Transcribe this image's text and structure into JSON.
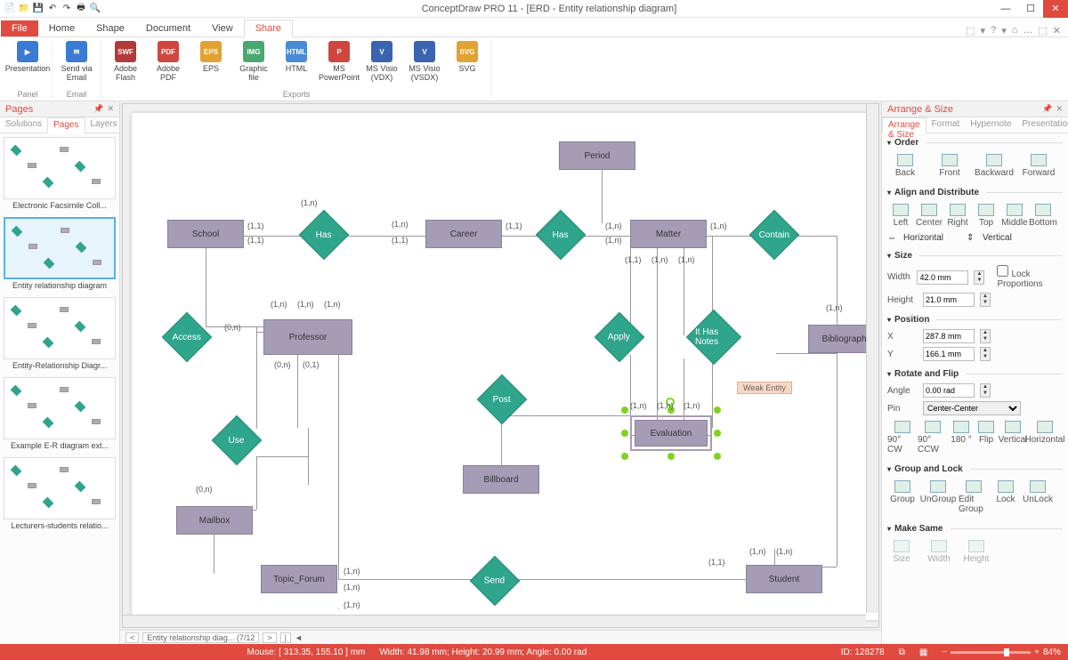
{
  "app": {
    "title": "ConceptDraw PRO 11 - [ERD - Entity relationship diagram]"
  },
  "window_buttons": {
    "min": "—",
    "max": "☐",
    "close": "✕"
  },
  "qat": [
    "📄",
    "📁",
    "💾",
    "↶",
    "↷",
    "🖶",
    "🔍"
  ],
  "ribbon_tabs": {
    "file": "File",
    "home": "Home",
    "shape": "Shape",
    "document": "Document",
    "view": "View",
    "share": "Share"
  },
  "right_icons": [
    "⬚",
    "▾",
    "?",
    "▾",
    "⌂",
    "…",
    "⬚",
    "✕"
  ],
  "ribbon": {
    "groups": [
      {
        "label": "Panel",
        "items": [
          {
            "name": "presentation-btn",
            "label": "Presentation",
            "color": "#3a7bd5",
            "icon": "▶"
          }
        ]
      },
      {
        "label": "Email",
        "items": [
          {
            "name": "send-email-btn",
            "label": "Send via Email",
            "color": "#3a7bd5",
            "icon": "✉"
          }
        ]
      },
      {
        "label": "Exports",
        "items": [
          {
            "name": "export-flash",
            "label": "Adobe Flash",
            "color": "#b23a3a",
            "icon": "SWF"
          },
          {
            "name": "export-pdf",
            "label": "Adobe PDF",
            "color": "#d0473f",
            "icon": "PDF"
          },
          {
            "name": "export-eps",
            "label": "EPS",
            "color": "#e2a233",
            "icon": "EPS"
          },
          {
            "name": "export-graphic",
            "label": "Graphic file",
            "color": "#4aa76f",
            "icon": "IMG"
          },
          {
            "name": "export-html",
            "label": "HTML",
            "color": "#4a8bd6",
            "icon": "HTML"
          },
          {
            "name": "export-ppt",
            "label": "MS PowerPoint",
            "color": "#d0473f",
            "icon": "P"
          },
          {
            "name": "export-vdx",
            "label": "MS Visio (VDX)",
            "color": "#3a63b0",
            "icon": "V"
          },
          {
            "name": "export-vsdx",
            "label": "MS Visio (VSDX)",
            "color": "#3a63b0",
            "icon": "V"
          },
          {
            "name": "export-svg",
            "label": "SVG",
            "color": "#e2a233",
            "icon": "SVG"
          }
        ]
      }
    ]
  },
  "pages_panel": {
    "title": "Pages",
    "tabs": {
      "solutions": "Solutions",
      "pages": "Pages",
      "layers": "Layers"
    },
    "thumbs": [
      {
        "label": "Electronic Facsimile Coll...",
        "selected": false
      },
      {
        "label": "Entity relationship diagram",
        "selected": true
      },
      {
        "label": "Entity-Relationship Diagr...",
        "selected": false
      },
      {
        "label": "Example E-R diagram ext...",
        "selected": false
      },
      {
        "label": "Lecturers-students relatio...",
        "selected": false
      }
    ]
  },
  "diagram": {
    "entities": {
      "period": "Period",
      "school": "School",
      "career": "Career",
      "matter": "Matter",
      "professor": "Professor",
      "bibliography": "Bibliography",
      "evaluation": "Evaluation",
      "billboard": "Billboard",
      "mailbox": "Mailbox",
      "topic_forum": "Topic_Forum",
      "student": "Student"
    },
    "relationships": {
      "has1": "Has",
      "has2": "Has",
      "contain": "Contain",
      "access": "Access",
      "apply": "Apply",
      "ithasnotes": "It Has Notes",
      "use": "Use",
      "post": "Post",
      "send": "Send"
    },
    "weak_label": "Weak Entity",
    "cards": {
      "c1": "(1,n)",
      "c2": "(1,1)",
      "c3": "(1,1)",
      "c4": "(1,n)",
      "c5": "(1,1)",
      "c6": "(1,n)",
      "c7": "(1,n)",
      "c8": "(1,n)",
      "c9": "(1,1)",
      "c10": "(1,n)",
      "c11": "(1,n)",
      "c12": "(0,n)",
      "c13": "(1,n)",
      "c14": "(1,n)",
      "c15": "(1,n)",
      "c16": "(0,n)",
      "c17": "(0,1)",
      "c18": "(1,n)",
      "c19": "(1,n)",
      "c20": "(1,n)",
      "c21": "(1,n)",
      "c22": "(1,n)",
      "c23": "(0,n)",
      "c24": "(1,n)",
      "c25": "(1,n)",
      "c26": "(1,1)",
      "c27": "(1,n)",
      "c28": "(1,n)"
    }
  },
  "bottom_tabs": {
    "nav_prev": "<",
    "page_label": "Entity relationship diag... (7/12",
    "nav_next": ">",
    "nav_last": "|",
    "scroll_left": "◄"
  },
  "arrange": {
    "title": "Arrange & Size",
    "tabs": {
      "arrange": "Arrange & Size",
      "format": "Format",
      "hypernote": "Hypernote",
      "presentation": "Presentation"
    },
    "order": {
      "hdr": "Order",
      "back": "Back",
      "front": "Front",
      "backward": "Backward",
      "forward": "Forward"
    },
    "align": {
      "hdr": "Align and Distribute",
      "left": "Left",
      "center": "Center",
      "right": "Right",
      "top": "Top",
      "middle": "Middle",
      "bottom": "Bottom",
      "horiz": "Horizontal",
      "vert": "Vertical"
    },
    "size": {
      "hdr": "Size",
      "width_l": "Width",
      "width_v": "42.0 mm",
      "height_l": "Height",
      "height_v": "21.0 mm",
      "lock": "Lock Proportions"
    },
    "pos": {
      "hdr": "Position",
      "x_l": "X",
      "x_v": "287.8 mm",
      "y_l": "Y",
      "y_v": "166.1 mm"
    },
    "rot": {
      "hdr": "Rotate and Flip",
      "angle_l": "Angle",
      "angle_v": "0.00 rad",
      "pin_l": "Pin",
      "pin_v": "Center-Center",
      "cw": "90° CW",
      "ccw": "90° CCW",
      "r180": "180 °",
      "flip": "Flip",
      "vert": "Vertical",
      "horiz": "Horizontal"
    },
    "group": {
      "hdr": "Group and Lock",
      "group": "Group",
      "ungroup": "UnGroup",
      "edit": "Edit Group",
      "lock": "Lock",
      "unlock": "UnLock"
    },
    "same": {
      "hdr": "Make Same",
      "size": "Size",
      "width": "Width",
      "height": "Height"
    }
  },
  "status": {
    "mouse": "Mouse: [ 313.35, 155.10 ] mm",
    "dims": "Width: 41.98 mm; Height: 20.99 mm; Angle: 0.00 rad",
    "id": "ID: 128278",
    "zoom": "84%"
  }
}
